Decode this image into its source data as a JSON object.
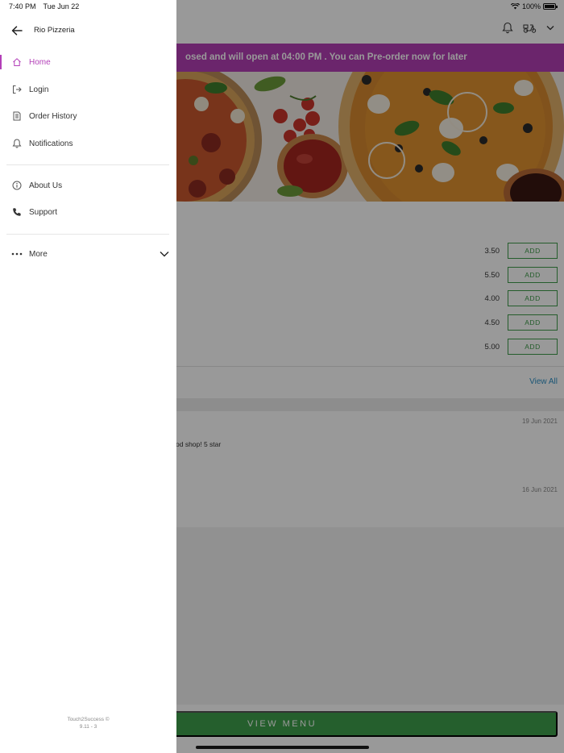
{
  "status_bar": {
    "time": "7:40 PM",
    "date": "Tue Jun 22",
    "battery": "100%"
  },
  "drawer": {
    "title": "Rio Pizzeria",
    "items_primary": [
      {
        "label": "Home",
        "icon": "home-icon",
        "active": true
      },
      {
        "label": "Login",
        "icon": "login-icon"
      },
      {
        "label": "Order History",
        "icon": "order-history-icon"
      },
      {
        "label": "Notifications",
        "icon": "bell-icon"
      }
    ],
    "items_secondary": [
      {
        "label": "About Us",
        "icon": "info-icon"
      },
      {
        "label": "Support",
        "icon": "phone-icon"
      }
    ],
    "more": {
      "label": "More",
      "icon": "more-dots-icon"
    },
    "footer_line1": "Touch2Success ©",
    "footer_line2": "9.11 - 3"
  },
  "app": {
    "banner": "osed and will open at 04:00 PM . You can Pre-order now for later",
    "menu_items": [
      {
        "price": "3.50",
        "button": "ADD"
      },
      {
        "price": "5.50",
        "button": "ADD"
      },
      {
        "price": "4.00",
        "button": "ADD"
      },
      {
        "price": "4.50",
        "button": "ADD"
      },
      {
        "price": "5.00",
        "button": "ADD"
      }
    ],
    "view_all": "View All",
    "reviews": [
      {
        "date": "19 Jun 2021",
        "text": "od shop! 5 star"
      },
      {
        "date": "16 Jun 2021",
        "text": ""
      }
    ],
    "view_menu": "VIEW MENU"
  },
  "colors": {
    "accent": "#b33fb8",
    "banner": "#b23fb5",
    "green": "#3f9e4c",
    "link": "#2d8fc4"
  }
}
